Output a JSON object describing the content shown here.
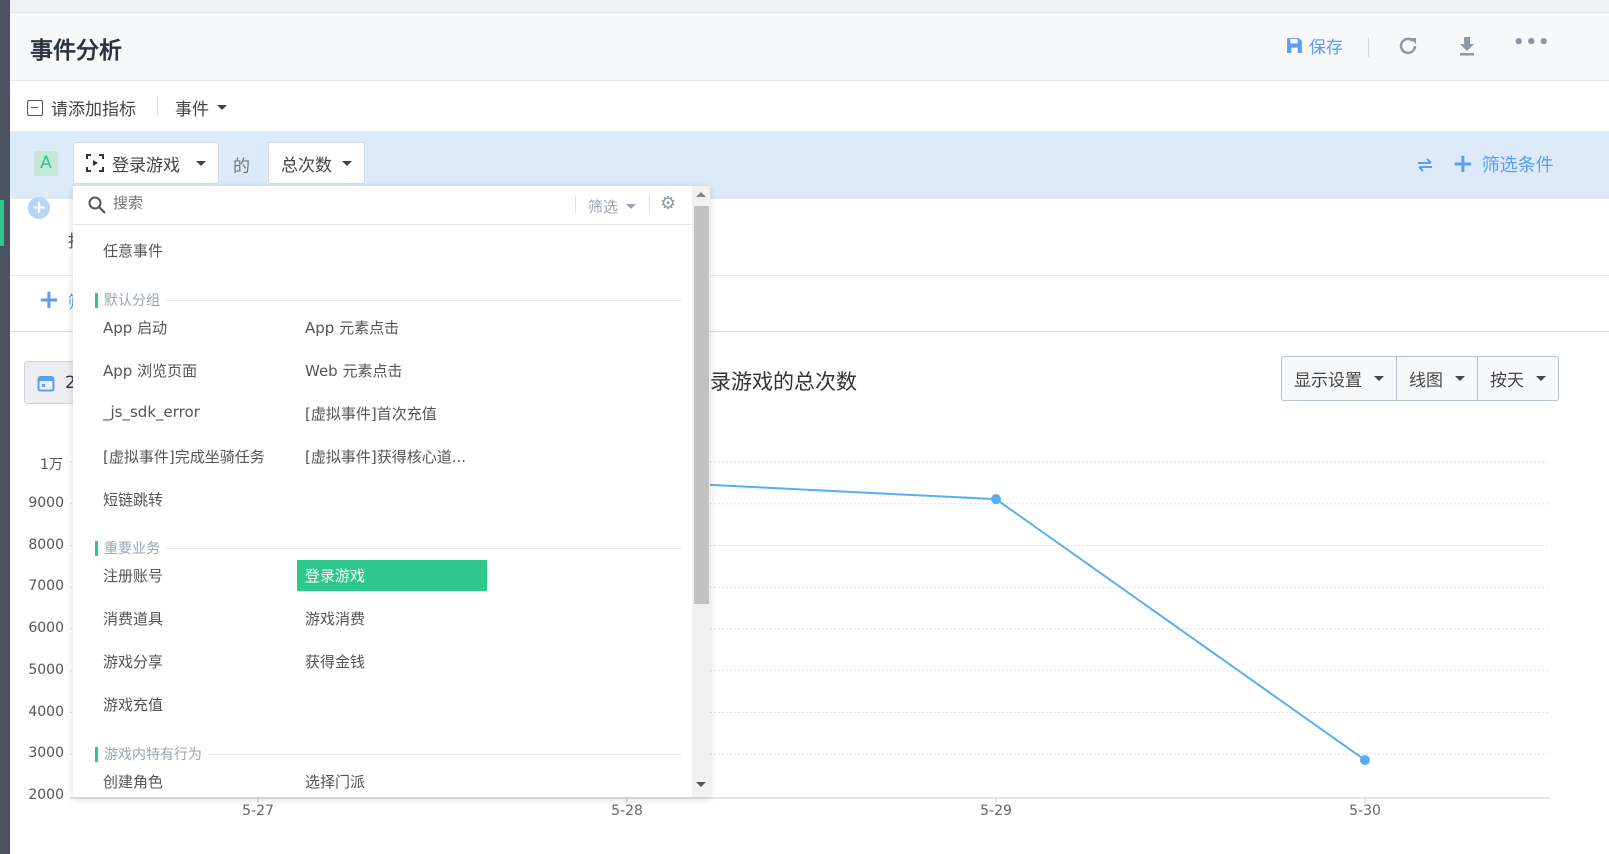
{
  "header": {
    "title": "事件分析",
    "save_label": "保存",
    "icons": [
      "save-icon",
      "refresh-icon",
      "download-icon",
      "more-icon"
    ]
  },
  "toolbar": {
    "add_metric": "请添加指标",
    "event_menu": "事件"
  },
  "metric": {
    "badge": "A",
    "event": "登录游戏",
    "of": "的",
    "measure": "总次数",
    "filter_label": "筛选条件"
  },
  "row4": {
    "partial_text": "指"
  },
  "row5": {
    "partial_text": "筛"
  },
  "date": {
    "partial_text": "2"
  },
  "dropdown": {
    "search_placeholder": "搜索",
    "filter_label": "筛选",
    "any_event": "任意事件",
    "groups": [
      {
        "name": "默认分组",
        "items": [
          "App 启动",
          "App 元素点击",
          "App 浏览页面",
          "Web 元素点击",
          "_js_sdk_error",
          "[虚拟事件]首次充值",
          "[虚拟事件]完成坐骑任务",
          "[虚拟事件]获得核心道...",
          "短链跳转"
        ]
      },
      {
        "name": "重要业务",
        "items": [
          "注册账号",
          "登录游戏",
          "消费道具",
          "游戏消费",
          "游戏分享",
          "获得金钱",
          "游戏充值"
        ]
      },
      {
        "name": "游戏内特有行为",
        "items": [
          "创建角色",
          "选择门派"
        ]
      }
    ],
    "selected": "登录游戏"
  },
  "chart_controls": {
    "display": "显示设置",
    "chart_type": "线图",
    "granularity": "按天"
  },
  "chart_data": {
    "type": "line",
    "title": "登录游戏的总次数",
    "title_visible": "录游戏的总次数",
    "categories": [
      "5-27",
      "5-28",
      "5-29",
      "5-30"
    ],
    "series": [
      {
        "name": "登录游戏的总次数",
        "values": [
          9600,
          9550,
          9110,
          2860
        ],
        "color": "#5aaef0"
      }
    ],
    "yticks": [
      "2000",
      "3000",
      "4000",
      "5000",
      "6000",
      "7000",
      "8000",
      "9000",
      "1万"
    ],
    "ylim": [
      2000,
      10000
    ],
    "grid": true
  }
}
